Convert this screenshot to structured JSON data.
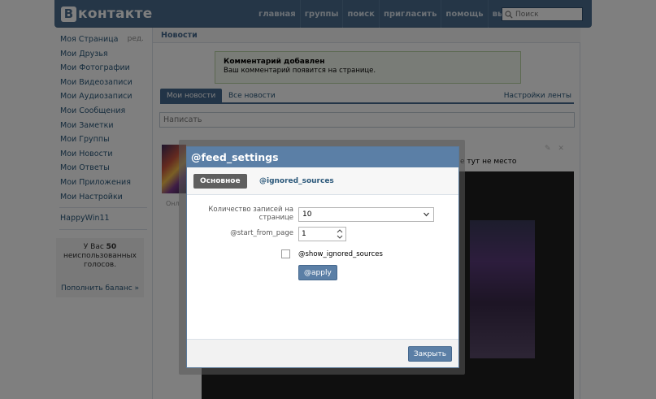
{
  "header": {
    "logo_letter": "В",
    "logo_text": "контакте",
    "nav": [
      "главная",
      "группы",
      "поиск",
      "пригласить",
      "помощь",
      "выйти"
    ],
    "search_placeholder": "Поиск"
  },
  "sidebar": {
    "items": [
      {
        "label": "Моя Страница",
        "edit": "ред."
      },
      {
        "label": "Мои Друзья"
      },
      {
        "label": "Мои Фотографии"
      },
      {
        "label": "Мои Видеозаписи"
      },
      {
        "label": "Мои Аудиозаписи"
      },
      {
        "label": "Мои Сообщения"
      },
      {
        "label": "Мои Заметки"
      },
      {
        "label": "Мои Группы"
      },
      {
        "label": "Мои Новости"
      },
      {
        "label": "Мои Ответы"
      },
      {
        "label": "Мои Приложения"
      },
      {
        "label": "Мои Настройки"
      }
    ],
    "extra_item": "HappyWin11",
    "promo": {
      "prefix": "У Вас",
      "count": "50",
      "suffix": "неиспользованных голосов.",
      "link": "Пополнить баланс »"
    }
  },
  "content": {
    "header_title": "Новости",
    "notice_title": "Комментарий добавлен",
    "notice_text": "Ваш комментарий появится на странице.",
    "tabs": {
      "my": "Мои новости",
      "all": "Все новости",
      "settings": "Настройки ленты"
    },
    "composer_placeholder": "Написать",
    "online": "Онл",
    "post_text": "е тут не место",
    "post_actions": "✎ ✕"
  },
  "modal": {
    "title": "@feed_settings",
    "tab_main": "Основное",
    "tab_ignored": "@ignored_sources",
    "count_label": "Количество записей на странице",
    "count_value": "10",
    "start_label": "@start_from_page",
    "start_value": "1",
    "show_ignored_label": "@show_ignored_sources",
    "apply_label": "@apply",
    "close_label": "Закрыть"
  }
}
